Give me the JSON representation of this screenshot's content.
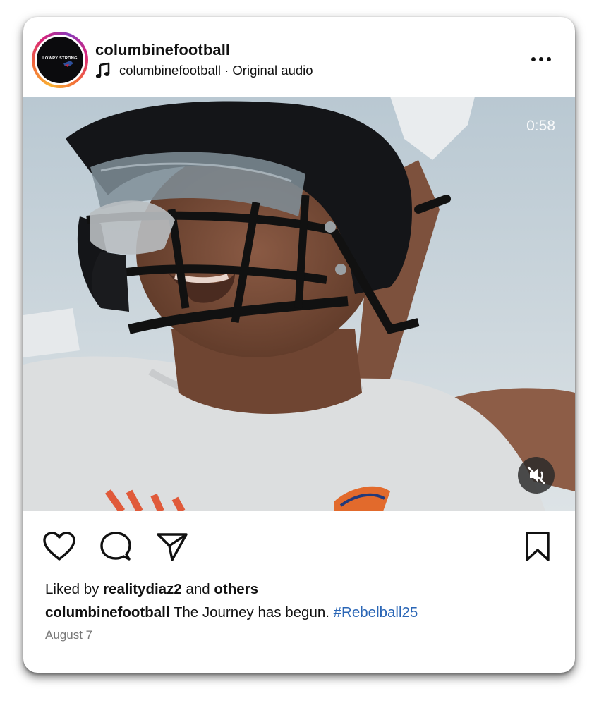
{
  "post": {
    "username": "columbinefootball",
    "avatar_text": "LOWRY STRONG",
    "audio_text": "columbinefootball · Original audio",
    "video_time": "0:58",
    "likes_prefix": "Liked by ",
    "likes_user": "realitydiaz2",
    "likes_middle": " and ",
    "likes_others": "others",
    "caption_user": "columbinefootball",
    "caption_text": " The Journey has begun. ",
    "caption_hashtag": "#Rebelball25",
    "date": "August 7"
  },
  "icons": {
    "more": "more-options-icon",
    "music": "music-note-icon",
    "mute": "muted-speaker-icon",
    "like": "heart-icon",
    "comment": "comment-bubble-icon",
    "share": "paper-plane-icon",
    "save": "bookmark-icon"
  },
  "colors": {
    "hashtag": "#2a66b6",
    "ring_gradient": [
      "#f9b233",
      "#f26a3a",
      "#d8257a",
      "#8a3ab9"
    ]
  }
}
